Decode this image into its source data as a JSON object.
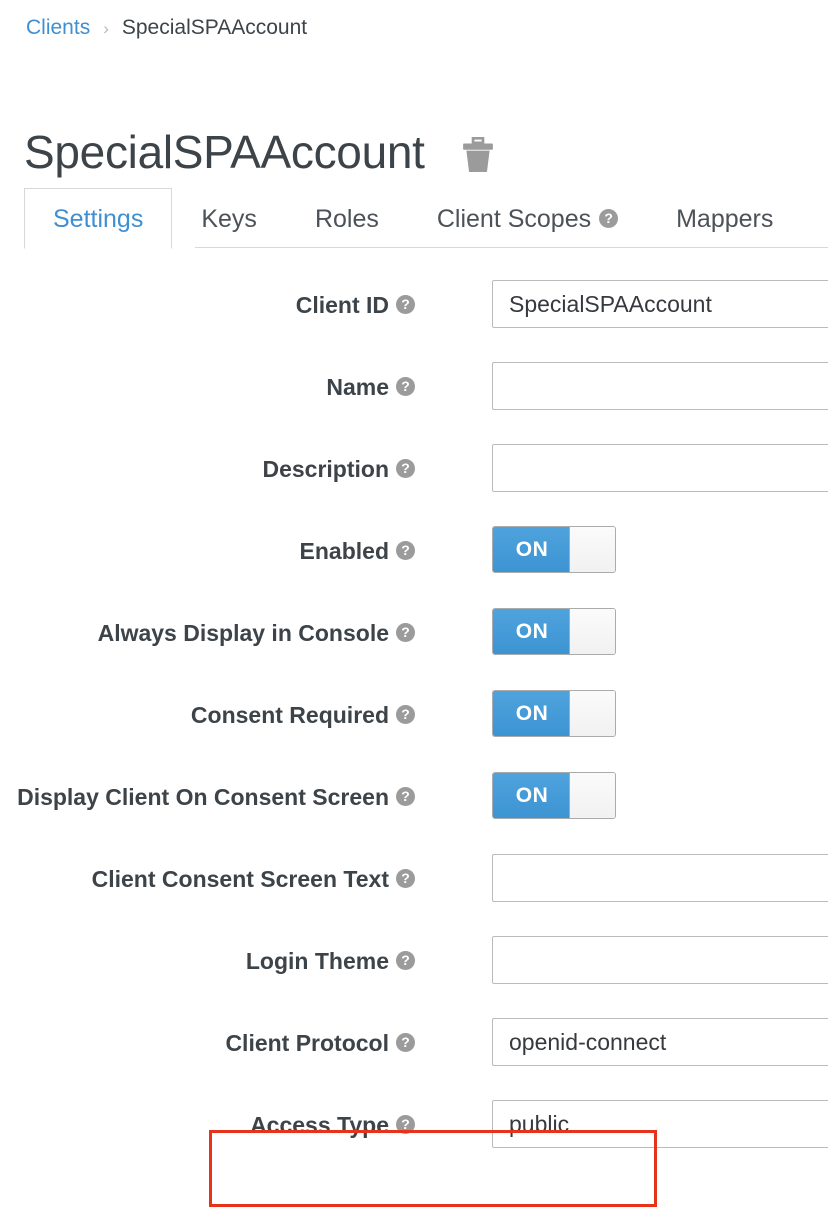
{
  "breadcrumb": {
    "parent": "Clients",
    "separator": "›",
    "current": "SpecialSPAAccount"
  },
  "header": {
    "title": "SpecialSPAAccount",
    "delete_icon": "trash-icon"
  },
  "tabs": [
    {
      "label": "Settings",
      "active": true,
      "help": false
    },
    {
      "label": "Keys",
      "active": false,
      "help": false
    },
    {
      "label": "Roles",
      "active": false,
      "help": false
    },
    {
      "label": "Client Scopes",
      "active": false,
      "help": true,
      "help_glyph": "?"
    },
    {
      "label": "Mappers",
      "active": false,
      "help": false
    }
  ],
  "help_glyph": "?",
  "form": {
    "rows": [
      {
        "label": "Client ID",
        "type": "text",
        "value": "SpecialSPAAccount",
        "placeholder": ""
      },
      {
        "label": "Name",
        "type": "text",
        "value": "",
        "placeholder": ""
      },
      {
        "label": "Description",
        "type": "text",
        "value": "",
        "placeholder": ""
      },
      {
        "label": "Enabled",
        "type": "toggle",
        "value": "ON"
      },
      {
        "label": "Always Display in Console",
        "type": "toggle",
        "value": "ON"
      },
      {
        "label": "Consent Required",
        "type": "toggle",
        "value": "ON"
      },
      {
        "label": "Display Client On Consent Screen",
        "type": "toggle",
        "value": "ON"
      },
      {
        "label": "Client Consent Screen Text",
        "type": "text",
        "value": "",
        "placeholder": ""
      },
      {
        "label": "Login Theme",
        "type": "text",
        "value": "",
        "placeholder": ""
      },
      {
        "label": "Client Protocol",
        "type": "select",
        "value": "openid-connect"
      },
      {
        "label": "Access Type",
        "type": "select",
        "value": "public"
      }
    ]
  },
  "annotation": {
    "highlight_color": "#e8331b",
    "target": "Access Type"
  },
  "colors": {
    "link": "#3f8fd2",
    "active_tab": "#3f8fd2",
    "toggle_on": "#3c94d2",
    "label": "#3d4449",
    "highlight": "#e8331b"
  }
}
